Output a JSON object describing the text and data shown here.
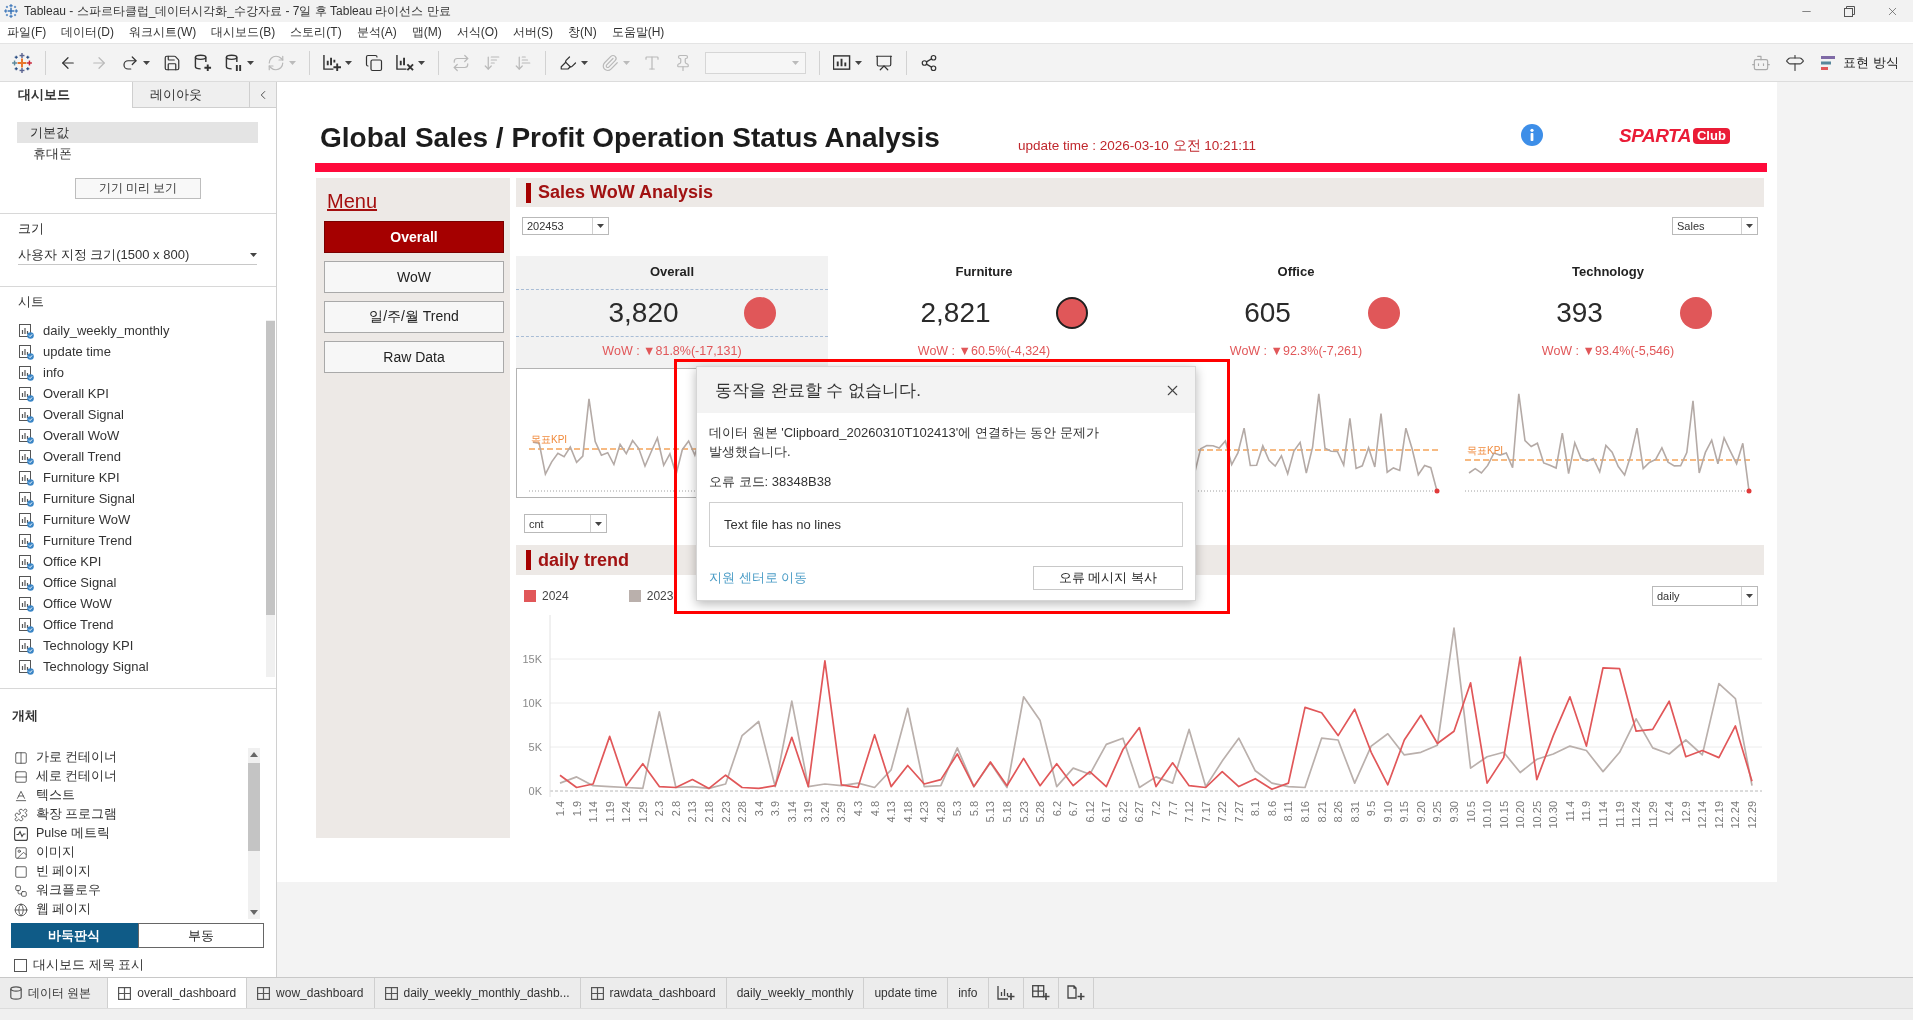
{
  "window": {
    "title": "Tableau - 스파르타클럽_데이터시각화_수강자료 - 7일 후 Tableau 라이선스 만료"
  },
  "menu": [
    "파일(F)",
    "데이터(D)",
    "워크시트(W)",
    "대시보드(B)",
    "스토리(T)",
    "분석(A)",
    "맵(M)",
    "서식(O)",
    "서버(S)",
    "창(N)",
    "도움말(H)"
  ],
  "toolbar": {
    "groups": [
      [
        {
          "kind": "icon",
          "disabled": false,
          "menu": false
        },
        {
          "kind": "icon",
          "disabled": true,
          "menu": false
        },
        {
          "kind": "icon",
          "disabled": false,
          "menu": true
        },
        {
          "kind": "icon",
          "disabled": false,
          "menu": false
        },
        {
          "kind": "icon",
          "disabled": false,
          "menu": false
        },
        {
          "kind": "icon",
          "disabled": false,
          "menu": true
        },
        {
          "kind": "icon",
          "disabled": true,
          "menu": true
        }
      ],
      [
        {
          "kind": "icon",
          "disabled": false,
          "menu": true
        },
        {
          "kind": "icon",
          "disabled": false,
          "menu": false
        },
        {
          "kind": "icon",
          "disabled": false,
          "menu": true
        }
      ],
      [
        {
          "kind": "icon",
          "disabled": true,
          "menu": false
        },
        {
          "kind": "icon",
          "disabled": true,
          "menu": false
        },
        {
          "kind": "icon",
          "disabled": true,
          "menu": false
        }
      ],
      [
        {
          "kind": "icon",
          "disabled": false,
          "menu": true
        },
        {
          "kind": "icon",
          "disabled": true,
          "menu": true
        },
        {
          "kind": "icon",
          "disabled": true,
          "menu": false
        },
        {
          "kind": "icon",
          "disabled": true,
          "menu": false
        },
        {
          "kind": "field",
          "disabled": true,
          "menu": true
        }
      ],
      [
        {
          "kind": "icon",
          "disabled": false,
          "menu": true
        },
        {
          "kind": "icon",
          "disabled": false,
          "menu": false
        }
      ],
      [
        {
          "kind": "icon",
          "disabled": false,
          "menu": false
        }
      ]
    ],
    "view_button": "표현 방식"
  },
  "side_panel": {
    "tabs": [
      {
        "label": "대시보드",
        "selected": true
      },
      {
        "label": "레이아웃",
        "selected": false
      }
    ],
    "devices": [
      {
        "label": "기본값",
        "selected": true,
        "children": [
          {
            "label": "휴대폰",
            "selected": false
          }
        ]
      }
    ],
    "preview_button": "기기 미리 보기",
    "size": {
      "heading": "크기",
      "value": "사용자 지정 크기(1500 x 800)"
    },
    "sheets": {
      "heading": "시트",
      "items": [
        "daily_weekly_monthly",
        "update time",
        "info",
        "Overall KPI",
        "Overall Signal",
        "Overall WoW",
        "Overall Trend",
        "Furniture KPI",
        "Furniture Signal",
        "Furniture WoW",
        "Furniture Trend",
        "Office KPI",
        "Office Signal",
        "Office WoW",
        "Office Trend",
        "Technology KPI",
        "Technology Signal"
      ]
    },
    "objects": {
      "heading": "개체",
      "items": [
        "가로 컨테이너",
        "세로 컨테이너",
        "텍스트",
        "확장 프로그램",
        "Pulse 메트릭",
        "이미지",
        "빈 페이지",
        "워크플로우",
        "웹 페이지"
      ]
    },
    "layout_toggle": [
      {
        "label": "바둑판식",
        "selected": true
      },
      {
        "label": "부동",
        "selected": false
      }
    ],
    "show_title": {
      "label": "대시보드 제목 표시",
      "checked": false
    }
  },
  "dashboard": {
    "title": "Global Sales / Profit Operation Status Analysis",
    "update_time": "update time : 2026-03-10 오전 10:21:11",
    "logo": {
      "word": "SPARTA",
      "badge": "Club"
    },
    "menu": {
      "heading": "Menu",
      "buttons": [
        {
          "label": "Overall",
          "selected": true
        },
        {
          "label": "WoW",
          "selected": false
        },
        {
          "label": "일/주/월 Trend",
          "selected": false
        },
        {
          "label": "Raw Data",
          "selected": false
        }
      ]
    },
    "sales_section": {
      "heading": "Sales WoW Analysis",
      "week_filter": "202453",
      "measure_filter": "Sales",
      "kpis": [
        {
          "name": "Overall",
          "value": "3,820",
          "wow": "WoW : ▼81.8%(-17,131)",
          "selected": true,
          "highlighted": false,
          "target_label": "목표KPI"
        },
        {
          "name": "Furniture",
          "value": "2,821",
          "wow": "WoW : ▼60.5%(-4,324)",
          "selected": false,
          "highlighted": true
        },
        {
          "name": "Office",
          "value": "605",
          "wow": "WoW : ▼92.3%(-7,261)",
          "selected": false,
          "highlighted": false
        },
        {
          "name": "Technology",
          "value": "393",
          "wow": "WoW : ▼93.4%(-5,546)",
          "selected": false,
          "highlighted": false,
          "target_label": "목표KPI"
        }
      ],
      "metric_filter": "cnt"
    },
    "trend_section": {
      "heading": "daily trend",
      "granularity_filter": "daily",
      "chart_data": {
        "type": "line",
        "grid": true,
        "ylim": [
          0,
          20
        ],
        "categories": [
          "1.4",
          "1.9",
          "1.14",
          "1.19",
          "1.24",
          "1.29",
          "2.3",
          "2.8",
          "2.13",
          "2.18",
          "2.23",
          "2.28",
          "3.4",
          "3.9",
          "3.14",
          "3.19",
          "3.24",
          "3.29",
          "4.3",
          "4.8",
          "4.13",
          "4.18",
          "4.23",
          "4.28",
          "5.3",
          "5.8",
          "5.13",
          "5.18",
          "5.23",
          "5.28",
          "6.2",
          "6.7",
          "6.12",
          "6.17",
          "6.22",
          "6.27",
          "7.2",
          "7.7",
          "7.12",
          "7.17",
          "7.22",
          "7.27",
          "8.1",
          "8.6",
          "8.11",
          "8.16",
          "8.21",
          "8.26",
          "8.31",
          "9.5",
          "9.10",
          "9.15",
          "9.20",
          "9.25",
          "9.30",
          "10.5",
          "10.10",
          "10.15",
          "10.20",
          "10.25",
          "10.30",
          "11.4",
          "11.9",
          "11.14",
          "11.19",
          "11.24",
          "11.29",
          "12.4",
          "12.9",
          "12.14",
          "12.19",
          "12.24",
          "12.29"
        ],
        "yticks": [
          {
            "value": 0,
            "label": "0K"
          },
          {
            "value": 5,
            "label": "5K"
          },
          {
            "value": 10,
            "label": "10K"
          },
          {
            "value": 15,
            "label": "15K"
          }
        ],
        "series": [
          {
            "name": "2024",
            "color": "#e15759",
            "values": [
              1.8,
              0.4,
              0.8,
              6.2,
              0.6,
              3.1,
              0.5,
              0.4,
              1.3,
              0.3,
              1.8,
              0.4,
              0.3,
              0.6,
              6.1,
              0.5,
              14.8,
              0.7,
              0.4,
              6.4,
              0.5,
              2.9,
              0.8,
              1.3,
              4.2,
              0.5,
              3.3,
              0.6,
              3.7,
              0.6,
              3.1,
              0.6,
              2.2,
              0.5,
              4.7,
              7.2,
              0.5,
              3.2,
              0.6,
              0.4,
              2.2,
              0.5,
              1.4,
              0.2,
              0.9,
              9.5,
              8.9,
              6.3,
              9.3,
              4.4,
              0.7,
              5.8,
              8.6,
              5.4,
              6.8,
              12.3,
              0.9,
              3.8,
              15.2,
              1.3,
              6.3,
              10.7,
              5.1,
              14,
              13.9,
              6.8,
              7,
              10.2,
              3.9,
              4.6,
              3.8,
              7.4,
              1.1
            ]
          },
          {
            "name": "2023",
            "color": "#bab0ac",
            "values": [
              0.9,
              1.6,
              0.6,
              0.5,
              0.4,
              0.3,
              9,
              0.4,
              0.5,
              0.3,
              0.8,
              6.3,
              7.9,
              0.5,
              10.2,
              0.5,
              0.8,
              0.6,
              0.9,
              0.4,
              2.4,
              9.4,
              0.5,
              0.6,
              4.9,
              0.5,
              3.2,
              0.4,
              10.7,
              8,
              0.5,
              2.6,
              1.9,
              5.3,
              6,
              0.4,
              1.6,
              0.9,
              7,
              0.5,
              3.4,
              6,
              2.3,
              0.9,
              0.5,
              0.4,
              6,
              5.8,
              0.9,
              5.1,
              6.5,
              4.1,
              4.4,
              5.2,
              18.5,
              2.6,
              3.9,
              4.4,
              2.1,
              3.6,
              4.2,
              5.1,
              4.6,
              2.2,
              4.4,
              8.2,
              4.9,
              4.2,
              5.8,
              4.1,
              12.2,
              10.5,
              0.6
            ]
          }
        ]
      }
    }
  },
  "dialog": {
    "title": "동작을 완료할 수 없습니다.",
    "message": "데이터 원본 'Clipboard_20260310T102413'에 연결하는 동안 문제가 발생했습니다.",
    "error_code": "오류 코드: 38348B38",
    "detail": "Text file has no lines",
    "link": "지원 센터로 이동",
    "copy_button": "오류 메시지 복사"
  },
  "bottom_tabs": [
    {
      "label": "데이터 원본",
      "kind": "datasource",
      "selected": false
    },
    {
      "label": "overall_dashboard",
      "kind": "dashboard",
      "selected": true
    },
    {
      "label": "wow_dashboard",
      "kind": "dashboard",
      "selected": false
    },
    {
      "label": "daily_weekly_monthly_dashb...",
      "kind": "dashboard",
      "selected": false
    },
    {
      "label": "rawdata_dashboard",
      "kind": "dashboard",
      "selected": false
    },
    {
      "label": "daily_weekly_monthly",
      "kind": "sheet",
      "selected": false
    },
    {
      "label": "update time",
      "kind": "sheet",
      "selected": false
    },
    {
      "label": "info",
      "kind": "sheet",
      "selected": false
    }
  ]
}
